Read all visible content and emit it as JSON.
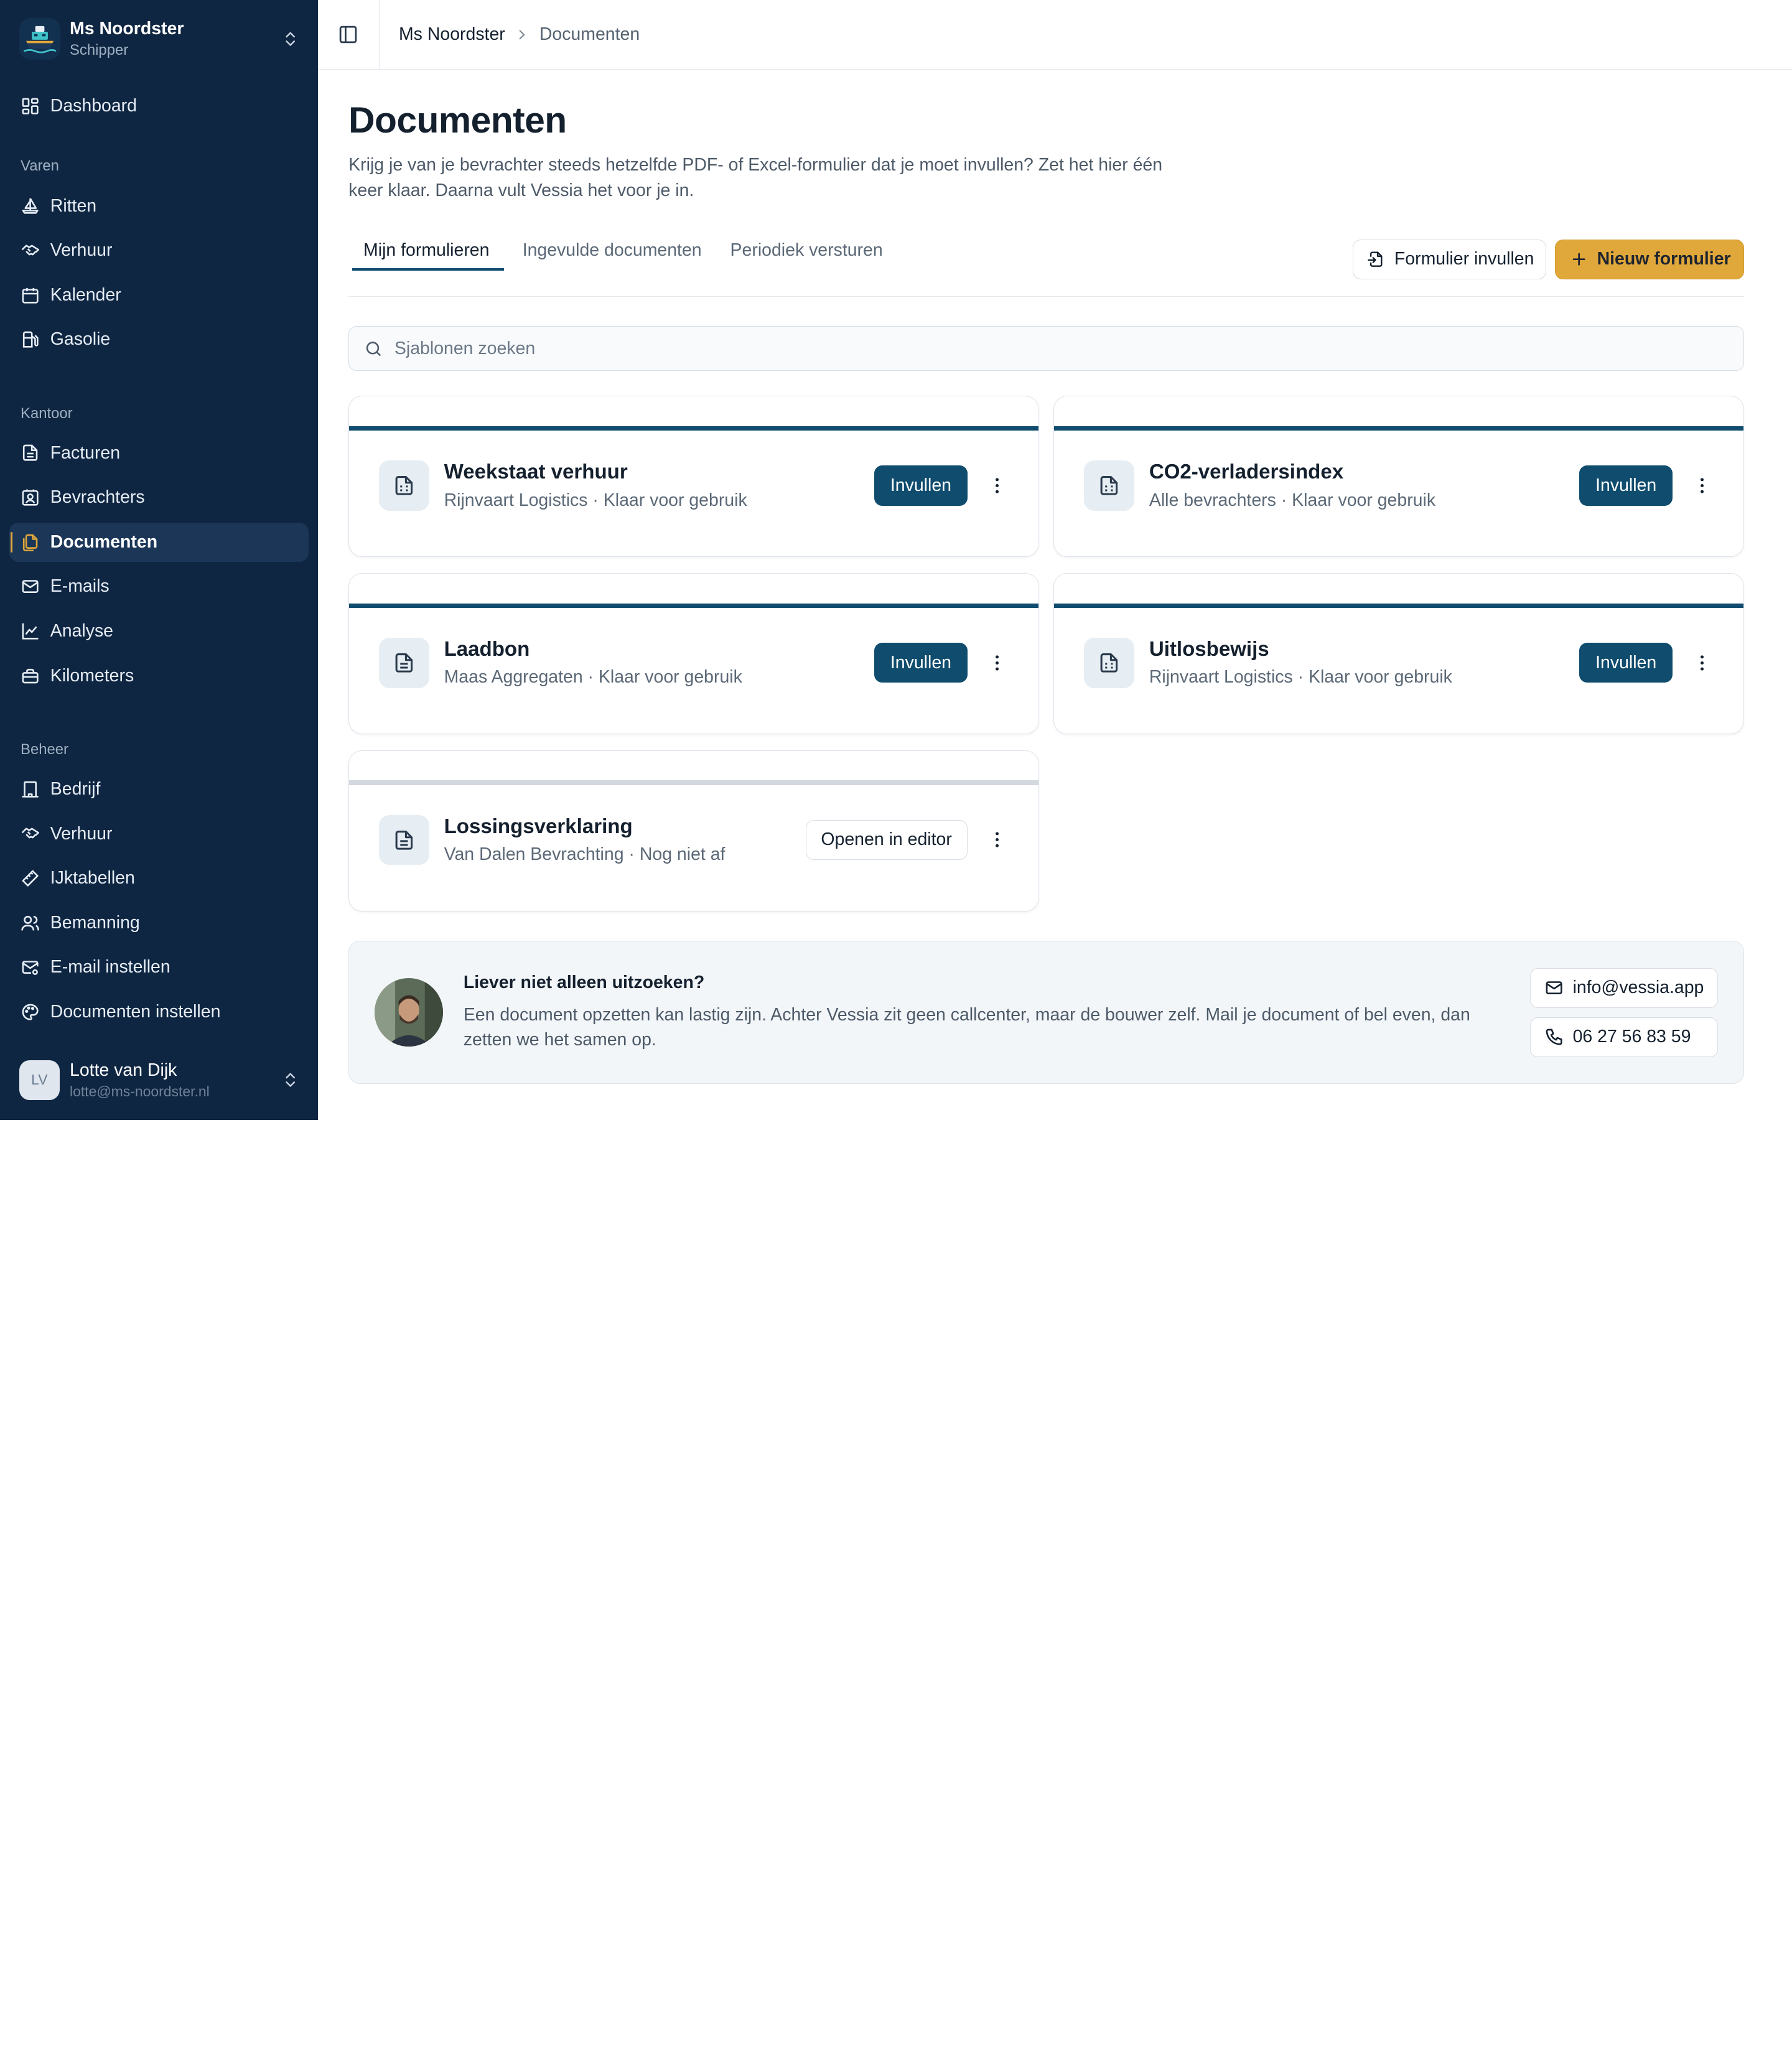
{
  "org": {
    "name": "Ms Noordster",
    "role": "Schipper"
  },
  "nav": {
    "dashboard": "Dashboard",
    "section_varen": "Varen",
    "ritten": "Ritten",
    "verhuur": "Verhuur",
    "kalender": "Kalender",
    "gasolie": "Gasolie",
    "section_kantoor": "Kantoor",
    "facturen": "Facturen",
    "bevrachters": "Bevrachters",
    "documenten": "Documenten",
    "emails": "E-mails",
    "analyse": "Analyse",
    "kilometers": "Kilometers",
    "section_beheer": "Beheer",
    "bedrijf": "Bedrijf",
    "verhuur_beheer": "Verhuur",
    "ijktabellen": "IJktabellen",
    "bemanning": "Bemanning",
    "email_instellen": "E-mail instellen",
    "documenten_instellen": "Documenten instellen"
  },
  "user": {
    "initials": "LV",
    "name": "Lotte van Dijk",
    "email": "lotte@ms-noordster.nl"
  },
  "breadcrumb": {
    "root": "Ms Noordster",
    "current": "Documenten"
  },
  "page": {
    "title": "Documenten",
    "subtitle": "Krijg je van je bevrachter steeds hetzelfde PDF- of Excel-formulier dat je moet invullen? Zet het hier één keer klaar. Daarna vult Vessia het voor je in."
  },
  "tabs": {
    "mijn": "Mijn formulieren",
    "ingevuld": "Ingevulde documenten",
    "periodiek": "Periodiek versturen"
  },
  "actions": {
    "fill_form": "Formulier invullen",
    "new_form": "Nieuw formulier"
  },
  "search": {
    "placeholder": "Sjablonen zoeken"
  },
  "cards": [
    {
      "title": "Weekstaat verhuur",
      "meta": "Rijnvaart Logistics · Klaar voor gebruik",
      "action": "Invullen"
    },
    {
      "title": "CO2-verladersindex",
      "meta": "Alle bevrachters · Klaar voor gebruik",
      "action": "Invullen"
    },
    {
      "title": "Laadbon",
      "meta": "Maas Aggregaten · Klaar voor gebruik",
      "action": "Invullen"
    },
    {
      "title": "Uitlosbewijs",
      "meta": "Rijnvaart Logistics · Klaar voor gebruik",
      "action": "Invullen"
    },
    {
      "title": "Lossingsverklaring",
      "meta": "Van Dalen Bevrachting · Nog niet af",
      "action": "Openen in editor"
    }
  ],
  "help": {
    "title": "Liever niet alleen uitzoeken?",
    "description": "Een document opzetten kan lastig zijn. Achter Vessia zit geen callcenter, maar de bouwer zelf. Mail je document of bel even, dan zetten we het samen op.",
    "email": "info@vessia.app",
    "phone": "06 27 56 83 59"
  },
  "colors": {
    "sidebar": "#0f2642",
    "primary": "#0f4c6e",
    "accent": "#e0a73a"
  }
}
